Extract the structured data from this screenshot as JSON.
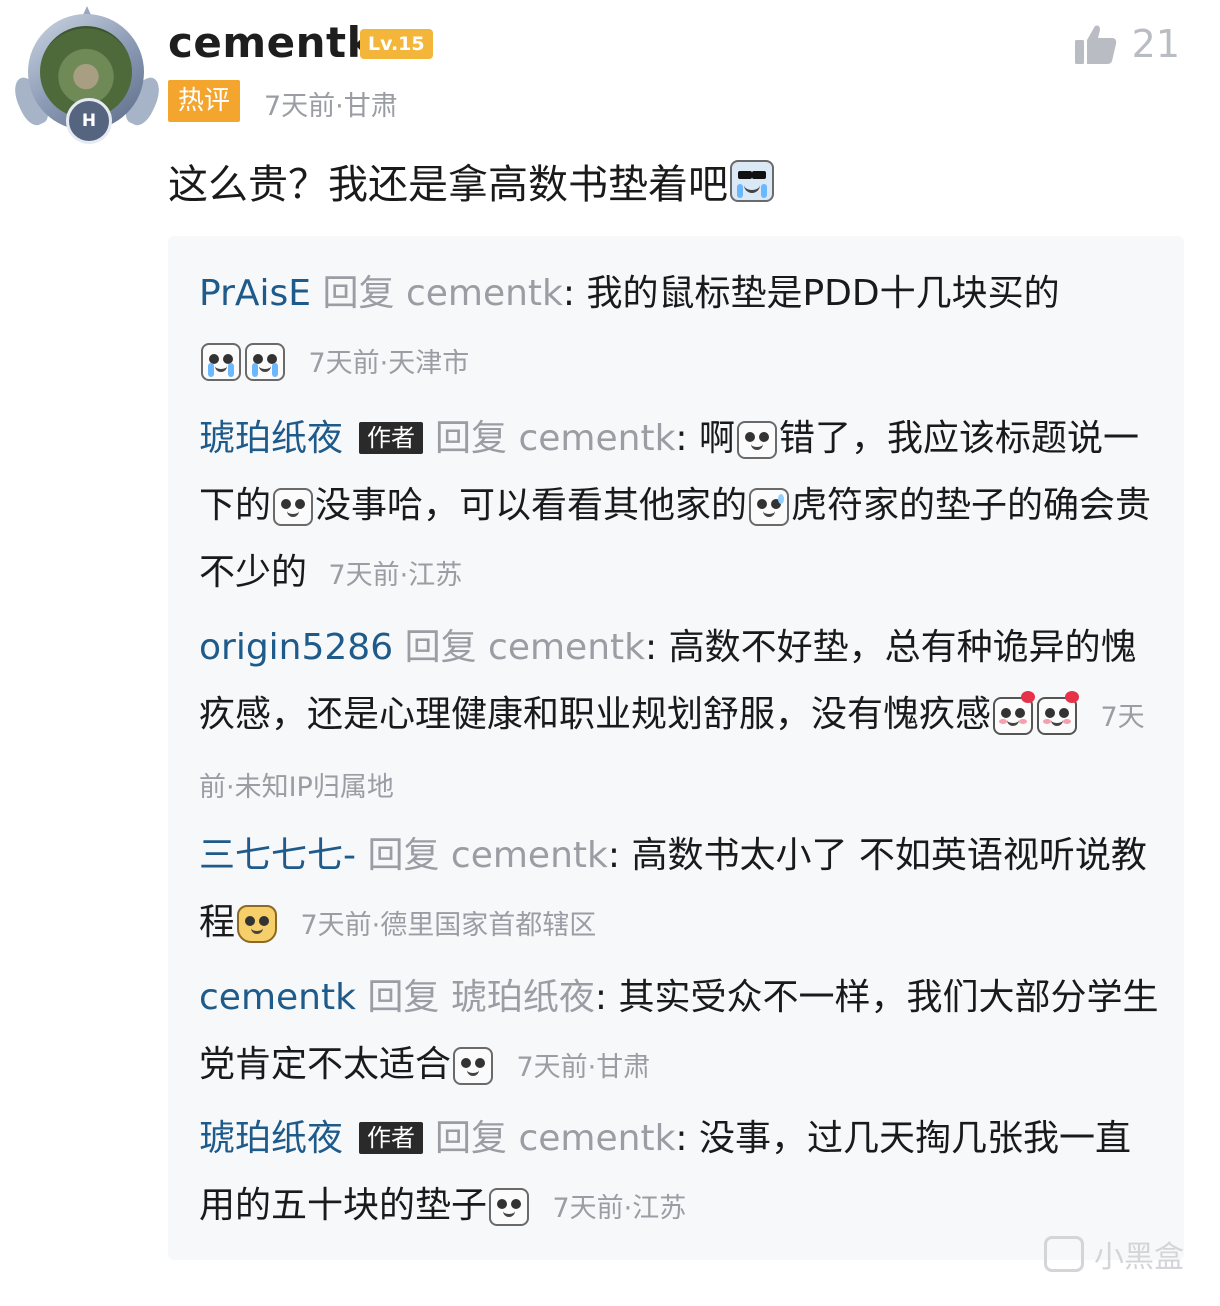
{
  "comment": {
    "username": "cementk",
    "level": "Lv.15",
    "like_count": "21",
    "hot_tag": "热评",
    "meta": "7天前·甘肃",
    "text": "这么贵？我还是拿高数书垫着吧",
    "text_emoji": "sunglasses-cry-emoji"
  },
  "replies": [
    {
      "name": "PrAisE",
      "reply_word": "回复",
      "target": "cementk",
      "colon": ":",
      "text": " 我的鼠标垫是PDD十几块买的",
      "time": "7天前·天津市"
    },
    {
      "name": "琥珀纸夜",
      "author_tag": "作者",
      "reply_word": "回复",
      "target": "cementk",
      "colon": ":",
      "text_a": " 啊",
      "text_b": "错了，我应该标题说一下的",
      "text_c": "没事哈，可以看看其他家的",
      "text_d": "虎符家的垫子的确会贵不少的",
      "time": "7天前·江苏"
    },
    {
      "name": "origin5286",
      "reply_word": "回复",
      "target": "cementk",
      "colon": ":",
      "text": " 高数不好垫，总有种诡异的愧疚感，还是心理健康和职业规划舒服，没有愧疚感",
      "time": "7天前·未知IP归属地"
    },
    {
      "name": "三七七七-",
      "reply_word": "回复",
      "target": "cementk",
      "colon": ":",
      "text": " 高数书太小了 不如英语视听说教程",
      "time": "7天前·德里国家首都辖区"
    },
    {
      "name": "cementk",
      "reply_word": "回复",
      "target": "琥珀纸夜",
      "colon": ":",
      "text": " 其实受众不一样，我们大部分学生党肯定不太适合",
      "time": "7天前·甘肃"
    },
    {
      "name": "琥珀纸夜",
      "author_tag": "作者",
      "reply_word": "回复",
      "target": "cementk",
      "colon": ":",
      "text": " 没事，过几天掏几张我一直用的五十块的垫子",
      "time": "7天前·江苏"
    }
  ],
  "avatar_badge": "H",
  "watermark": "小黑盒",
  "colors": {
    "accent_name": "#1e5a8a",
    "hot_tag": "#f4a52d",
    "level_badge": "#f4b63a",
    "meta_gray": "#9a9da3"
  }
}
